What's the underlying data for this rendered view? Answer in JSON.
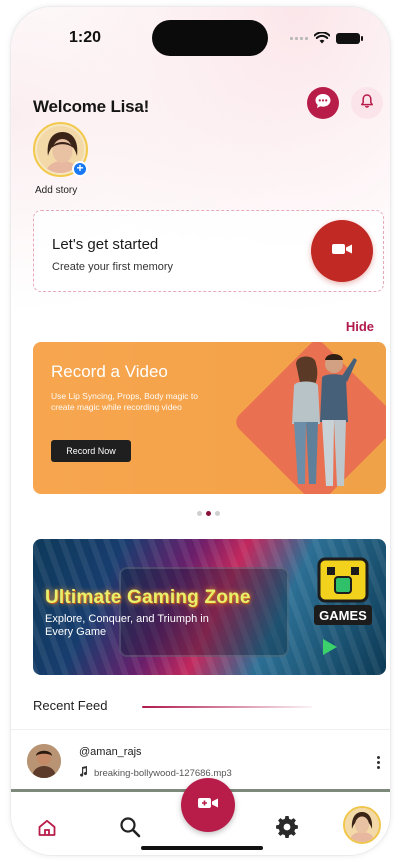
{
  "status_bar": {
    "time": "1:20"
  },
  "header": {
    "welcome": "Welcome Lisa!"
  },
  "story": {
    "add_label": "Add story"
  },
  "get_started": {
    "title": "Let's get started",
    "subtitle": "Create your first memory"
  },
  "hide_label": "Hide",
  "record_banner": {
    "title": "Record a Video",
    "description": "Use Lip Syncing, Props, Body magic to create magic while recording video",
    "button": "Record Now"
  },
  "carousel": {
    "count": 3,
    "active_index": 1
  },
  "game_banner": {
    "title": "Ultimate Gaming Zone",
    "subtitle": "Explore, Conquer, and Triumph in Every Game",
    "logo_text": "GAMES"
  },
  "recent_feed": {
    "title": "Recent Feed",
    "items": [
      {
        "user": "@aman_rajs",
        "song": "breaking-bollywood-127686.mp3"
      }
    ]
  },
  "colors": {
    "accent": "#b81d4a",
    "record_red": "#c12a24",
    "banner_orange": "#f7a64f"
  }
}
